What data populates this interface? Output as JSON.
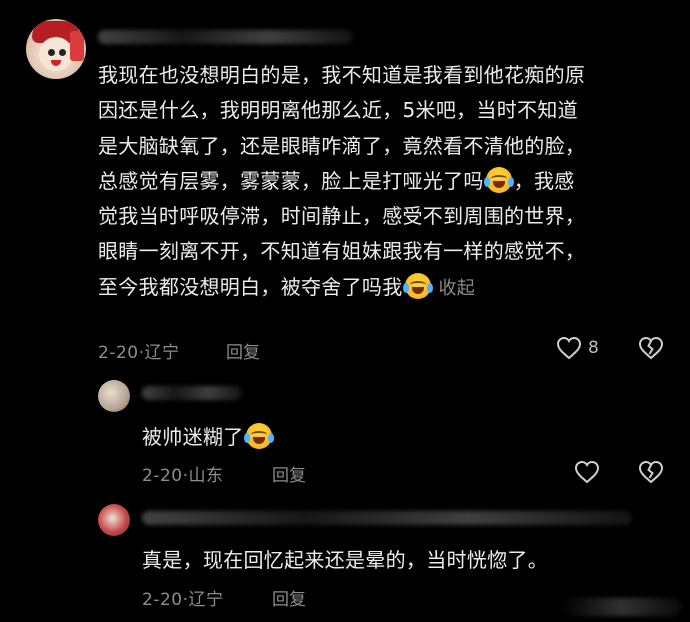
{
  "main_comment": {
    "text_lines": [
      "我现在也没想明白的是，我不知道是我看到他花痴的原",
      "因还是什么，我明明离他那么近，5米吧，当时不知道",
      "是大脑缺氧了，还是眼睛咋滴了，竟然看不清他的脸，",
      "总感觉有层雾，雾蒙蒙，脸上是打哑光了吗"
    ],
    "text_line5_after_emoji": "，我感",
    "text_lines_rest": [
      "觉我当时呼吸停滞，时间静止，感受不到周围的世界，",
      "眼睛一刻离不开，不知道有姐妹跟我有一样的感觉不，"
    ],
    "text_last_line": "至今我都没想明白，被夺舍了吗我",
    "collapse_label": "收起",
    "date_location": "2-20·辽宁",
    "reply_label": "回复",
    "like_count": "8"
  },
  "replies": [
    {
      "text": "被帅迷糊了",
      "date_location": "2-20·山东",
      "reply_label": "回复"
    },
    {
      "text": "真是，现在回忆起来还是晕的，当时恍惚了。",
      "date_location": "2-20·辽宁",
      "reply_label": "回复"
    }
  ],
  "icons": {
    "like": "heart-outline-icon",
    "dislike": "broken-heart-icon",
    "emoji": "crying-laughing-emoji"
  }
}
